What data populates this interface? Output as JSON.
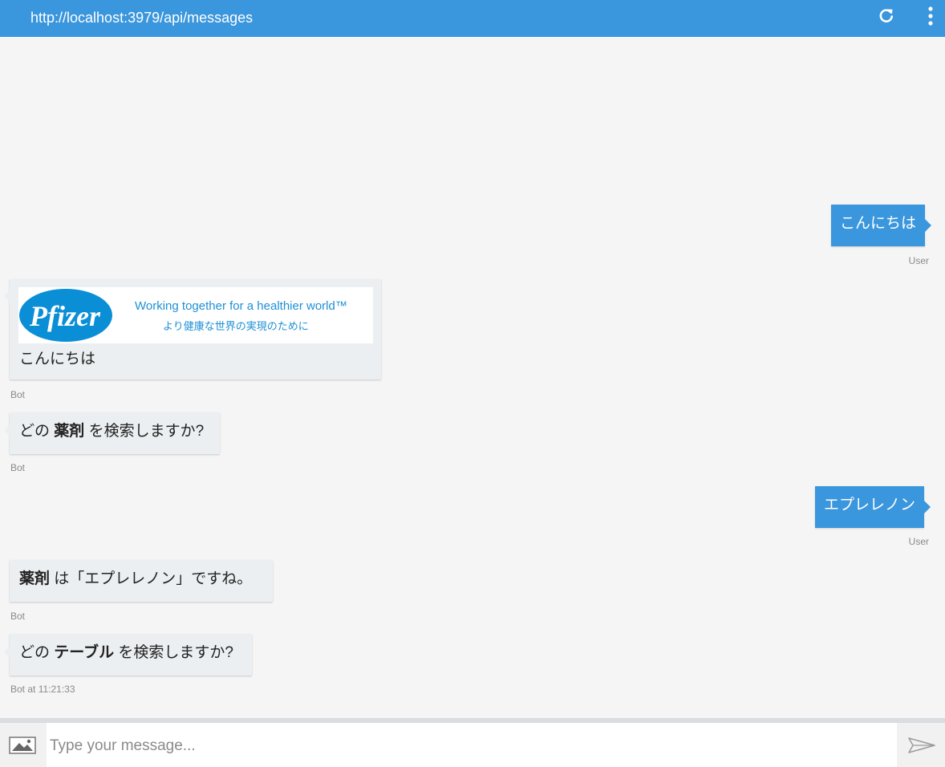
{
  "header": {
    "url": "http://localhost:3979/api/messages",
    "refresh_icon": "refresh-icon",
    "menu_icon": "more-vertical-icon"
  },
  "messages": [
    {
      "from": "user",
      "text": "こんにちは",
      "meta": "User"
    },
    {
      "from": "bot",
      "card": {
        "logo_text": "Pfizer",
        "tagline_en": "Working together for a healthier world™",
        "tagline_ja": "より健康な世界の実現のために"
      },
      "text": "こんにちは",
      "meta": "Bot"
    },
    {
      "from": "bot",
      "pre": "どの ",
      "bold": "薬剤",
      "post": " を検索しますか?",
      "meta": "Bot"
    },
    {
      "from": "user",
      "text": "エプレレノン",
      "meta": "User"
    },
    {
      "from": "bot",
      "pre": "",
      "bold": "薬剤",
      "post": " は「エプレレノン」ですね。",
      "meta": "Bot"
    },
    {
      "from": "bot",
      "pre": "どの ",
      "bold": "テーブル",
      "post": " を検索しますか?",
      "meta": "Bot at 11:21:33"
    }
  ],
  "composer": {
    "placeholder": "Type your message...",
    "image_icon": "image-upload-icon",
    "send_icon": "send-icon"
  },
  "colors": {
    "accent": "#3a96dd",
    "bot_bubble": "#eceff1",
    "background": "#f5f5f5"
  }
}
